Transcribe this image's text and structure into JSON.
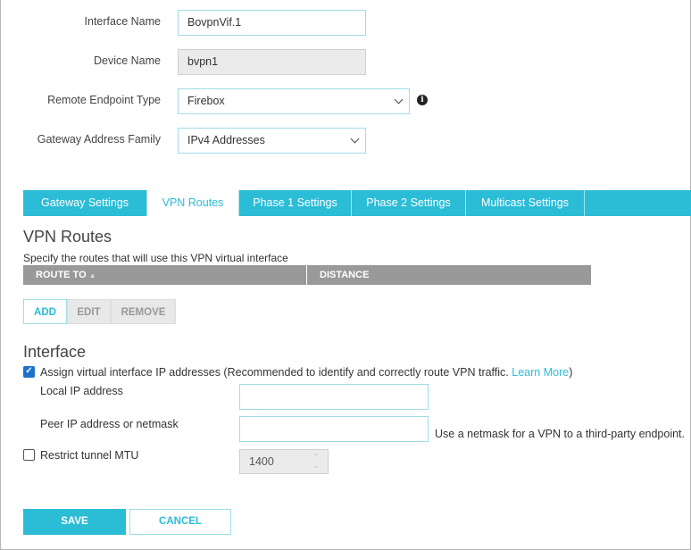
{
  "form": {
    "interface_name": {
      "label": "Interface Name",
      "value": "BovpnVif.1"
    },
    "device_name": {
      "label": "Device Name",
      "value": "bvpn1"
    },
    "remote_endpoint_type": {
      "label": "Remote Endpoint Type",
      "value": "Firebox"
    },
    "gateway_address_family": {
      "label": "Gateway Address Family",
      "value": "IPv4 Addresses"
    }
  },
  "tabs": [
    "Gateway Settings",
    "VPN Routes",
    "Phase 1 Settings",
    "Phase 2 Settings",
    "Multicast Settings"
  ],
  "routes": {
    "title": "VPN Routes",
    "subtitle": "Specify the routes that will use this VPN virtual interface",
    "columns": [
      "ROUTE TO",
      "DISTANCE"
    ],
    "buttons": {
      "add": "ADD",
      "edit": "EDIT",
      "remove": "REMOVE"
    }
  },
  "interface": {
    "title": "Interface",
    "assign_label": "Assign virtual interface IP addresses (Recommended to identify and correctly route VPN traffic.",
    "learn_more": "Learn More",
    "close_paren": ")",
    "assign_checked": true,
    "local_ip_label": "Local IP address",
    "local_ip_value": "",
    "peer_ip_label": "Peer IP address or netmask",
    "peer_ip_value": "",
    "peer_hint": "Use a netmask for a VPN to a third-party endpoint.",
    "mtu_label": "Restrict tunnel MTU",
    "mtu_checked": false,
    "mtu_value": "1400"
  },
  "actions": {
    "save": "SAVE",
    "cancel": "CANCEL"
  },
  "colors": {
    "accent": "#2bbcd6",
    "header_gray": "#999999"
  }
}
